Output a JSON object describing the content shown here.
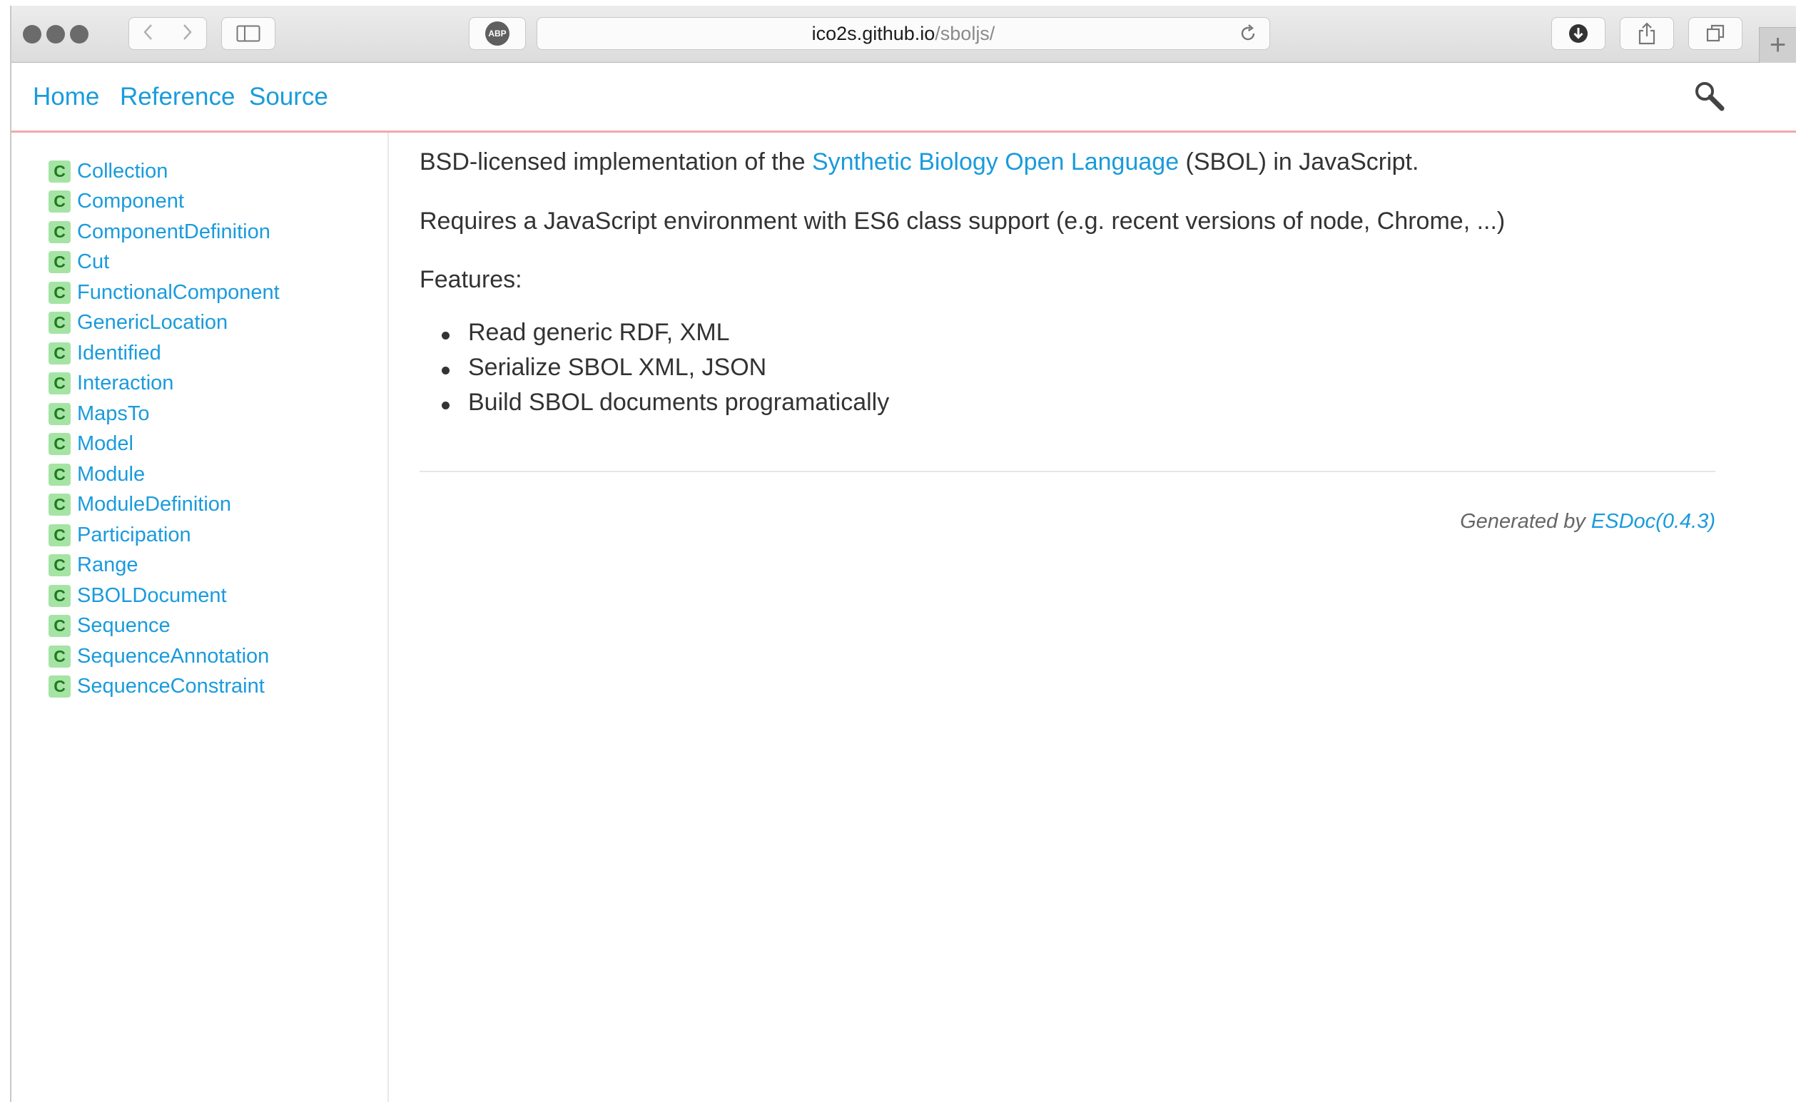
{
  "browser": {
    "url_domain": "ico2s.github.io",
    "url_path": "/sboljs/",
    "adblock_label": "ABP",
    "new_tab_label": "+"
  },
  "nav": {
    "home": "Home",
    "reference": "Reference",
    "source": "Source"
  },
  "sidebar": {
    "badge": "C",
    "items": [
      "Collection",
      "Component",
      "ComponentDefinition",
      "Cut",
      "FunctionalComponent",
      "GenericLocation",
      "Identified",
      "Interaction",
      "MapsTo",
      "Model",
      "Module",
      "ModuleDefinition",
      "Participation",
      "Range",
      "SBOLDocument",
      "Sequence",
      "SequenceAnnotation",
      "SequenceConstraint"
    ]
  },
  "content": {
    "intro_prefix": "BSD-licensed implementation of the ",
    "intro_link": "Synthetic Biology Open Language",
    "intro_suffix": " (SBOL) in JavaScript.",
    "requires": "Requires a JavaScript environment with ES6 class support (e.g. recent versions of node, Chrome, ...)",
    "features_heading": "Features:",
    "features": [
      "Read generic RDF, XML",
      "Serialize SBOL XML, JSON",
      "Build SBOL documents programatically"
    ]
  },
  "footer": {
    "generated_by": "Generated by ",
    "esdoc_link": "ESDoc(0.4.3)"
  },
  "colors": {
    "link": "#1a9bdc",
    "class_badge_bg": "#a5e4a5",
    "navbar_border": "#f2a7ad"
  }
}
